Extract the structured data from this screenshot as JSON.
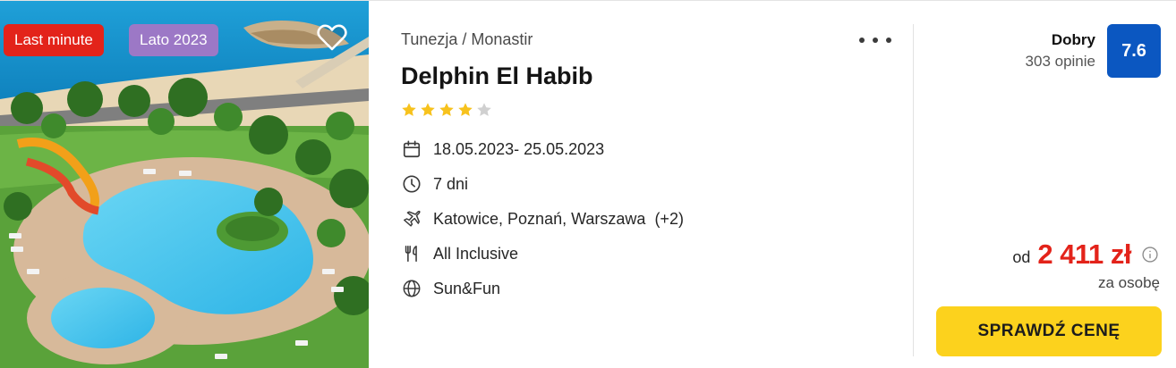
{
  "offer": {
    "badges": {
      "last_minute": "Last minute",
      "season": "Lato 2023"
    },
    "location": "Tunezja / Monastir",
    "hotel_name": "Delphin El Habib",
    "stars": {
      "rating": 4,
      "max": 5
    },
    "features": {
      "dates": "18.05.2023- 25.05.2023",
      "duration": "7 dni",
      "departure": "Katowice, Poznań, Warszawa  (+2)",
      "board": "All Inclusive",
      "trip_type": "Sun&Fun"
    },
    "review": {
      "label": "Dobry",
      "count": "303 opinie",
      "score": "7.6"
    },
    "price": {
      "prefix": "od",
      "value": "2 411 zł",
      "per": "za osobę"
    },
    "cta_label": "SPRAWDŹ CENĘ"
  },
  "colors": {
    "last_minute_badge": "#e3231a",
    "season_badge": "#9c78c6",
    "score_badge": "#0b57c1",
    "price": "#e3231a",
    "cta": "#fcd21d",
    "star": "#f7c21d",
    "star_empty": "#d0d0d0"
  },
  "icons": {
    "favorite": "heart-icon",
    "more": "more-horizontal-icon",
    "dates": "calendar-icon",
    "duration": "clock-icon",
    "departure": "plane-icon",
    "board": "cutlery-icon",
    "trip_type": "globe-icon",
    "price_info": "info-icon"
  }
}
